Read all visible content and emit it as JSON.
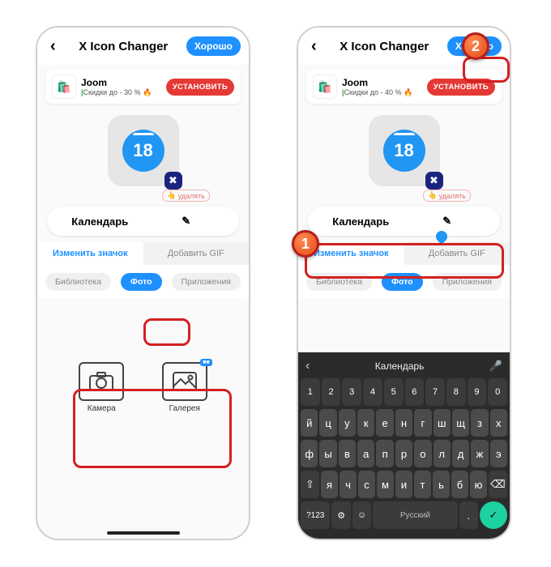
{
  "header": {
    "title": "X Icon Changer",
    "good": "Хорошо"
  },
  "banner": {
    "title": "Joom",
    "sub_prefix": "Скидки до - ",
    "percent_left": "30 %",
    "percent_right": "40 %",
    "flame": "🔥",
    "install": "УСТАНОВИТЬ"
  },
  "icon": {
    "day": "18",
    "delete": "удалять",
    "delete_hand": "👆"
  },
  "app_name": "Календарь",
  "tabs": {
    "change": "Изменить значок",
    "gif": "Добавить GIF"
  },
  "chips": {
    "lib": "Библиотека",
    "photo": "Фото",
    "apps": "Приложения"
  },
  "options": {
    "camera": "Камера",
    "gallery": "Галерея",
    "gal_badge": "■■"
  },
  "keyboard": {
    "suggestion": "Календарь",
    "row_num": [
      "1",
      "2",
      "3",
      "4",
      "5",
      "6",
      "7",
      "8",
      "9",
      "0"
    ],
    "row1": [
      "й",
      "ц",
      "у",
      "к",
      "е",
      "н",
      "г",
      "ш",
      "щ",
      "з",
      "х"
    ],
    "row2": [
      "ф",
      "ы",
      "в",
      "а",
      "п",
      "р",
      "о",
      "л",
      "д",
      "ж",
      "э"
    ],
    "row3": [
      "я",
      "ч",
      "с",
      "м",
      "и",
      "т",
      "ь",
      "б",
      "ю"
    ],
    "shift": "⇧",
    "back": "⌫",
    "sym": "?123",
    "lang": "Русский",
    "dot": ".",
    "chev": "‹",
    "mic": "🎤",
    "gear": "⚙",
    "enter": "✓",
    "emoji": "☺"
  },
  "callouts": {
    "one": "1",
    "two": "2"
  }
}
